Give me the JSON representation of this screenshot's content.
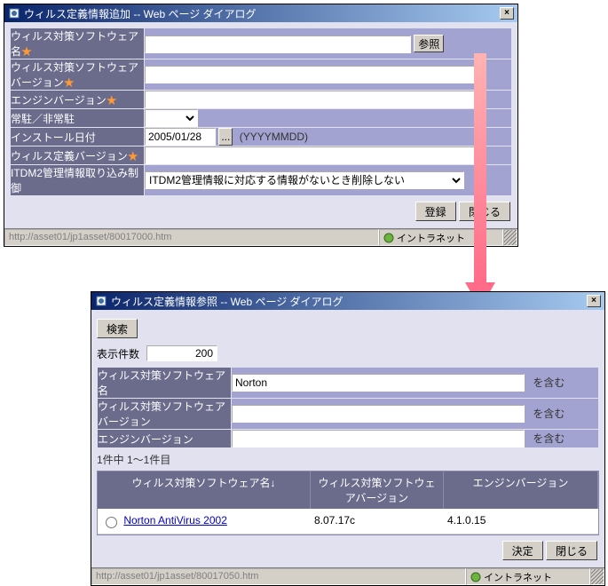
{
  "dialog1": {
    "title": "ウィルス定義情報追加 -- Web ページ ダイアログ",
    "fields": {
      "av_name": {
        "label": "ウィルス対策ソフトウェア名",
        "required": true,
        "value": ""
      },
      "av_version": {
        "label": "ウィルス対策ソフトウェアバージョン",
        "required": true,
        "value": ""
      },
      "engine_version": {
        "label": "エンジンバージョン",
        "required": true,
        "value": ""
      },
      "resident": {
        "label": "常駐／非常駐",
        "value": ""
      },
      "install_date": {
        "label": "インストール日付",
        "value": "2005/01/28",
        "hint": "(YYYYMMDD)"
      },
      "def_version": {
        "label": "ウィルス定義バージョン",
        "required": true,
        "value": ""
      },
      "itdm2": {
        "label": "ITDM2管理情報取り込み制御",
        "value": "ITDM2管理情報に対応する情報がないとき削除しない"
      }
    },
    "buttons": {
      "browse": "参照",
      "register": "登録",
      "close": "閉じる",
      "date_pick": "..."
    },
    "status_url": "http://asset01/jp1asset/80017000.htm",
    "status_zone": "イントラネット"
  },
  "dialog2": {
    "title": "ウィルス定義情報参照 -- Web ページ ダイアログ",
    "buttons": {
      "search": "検索",
      "decide": "決定",
      "close": "閉じる"
    },
    "count_label": "表示件数",
    "count_value": "200",
    "filters": {
      "av_name": {
        "label": "ウィルス対策ソフトウェア名",
        "value": "Norton",
        "suffix": "を含む"
      },
      "av_version": {
        "label": "ウィルス対策ソフトウェアバージョン",
        "value": "",
        "suffix": "を含む"
      },
      "engine_version": {
        "label": "エンジンバージョン",
        "value": "",
        "suffix": "を含む"
      }
    },
    "result_count": "1件中 1～1件目",
    "headers": {
      "c1": "ウィルス対策ソフトウェア名↓",
      "c2": "ウィルス対策ソフトウェアバージョン",
      "c3": "エンジンバージョン"
    },
    "rows": [
      {
        "name": "Norton AntiVirus 2002",
        "ver": "8.07.17c",
        "engine": "4.1.0.15"
      }
    ],
    "status_url": "http://asset01/jp1asset/80017050.htm",
    "status_zone": "イントラネット"
  }
}
